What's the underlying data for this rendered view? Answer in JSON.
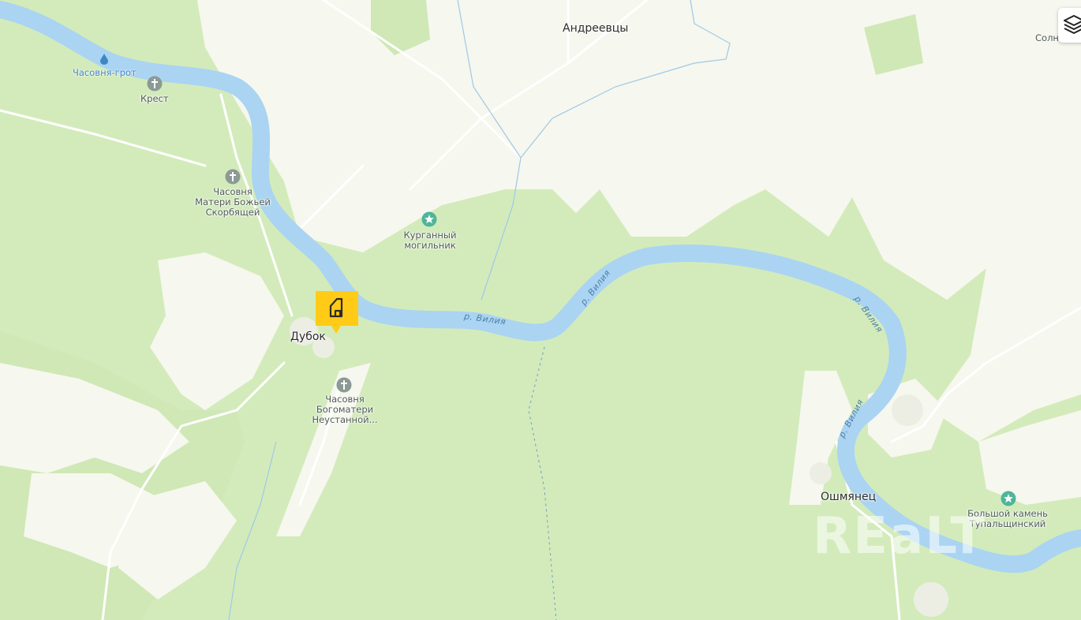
{
  "map": {
    "colors": {
      "field": "#f6f7ee",
      "forest": "#d3ebbb",
      "forest_dark": "#c7e4ab",
      "river": "#aad4f2",
      "road": "#ffffff",
      "marker": "#ffcb16"
    },
    "towns": {
      "andreevtsy": "Андреевцы",
      "dubok": "Дубок",
      "oshmyanets": "Ошмянец",
      "solne": "Солн"
    },
    "pois": {
      "grotto": "Часовня-грот",
      "cross": "Крест",
      "chapel_sorrowful": [
        "Часовня",
        "Матери Божьей",
        "Скорбящей"
      ],
      "kurgan": [
        "Курганный",
        "могильник"
      ],
      "chapel_perpetual": [
        "Часовня",
        "Богоматери",
        "Неустанной..."
      ],
      "big_stone": [
        "Большой камень",
        "Тупальщинский"
      ]
    },
    "river_labels": [
      "р. Вилия",
      "р. Вилия",
      "р. Вилия",
      "р. Вилия"
    ],
    "icons": {
      "marker": "house-icon",
      "layers": "layers-icon",
      "grotto": "water-drop-icon",
      "cross": "cross-icon",
      "star": "star-icon"
    },
    "watermark": "REaLT"
  }
}
